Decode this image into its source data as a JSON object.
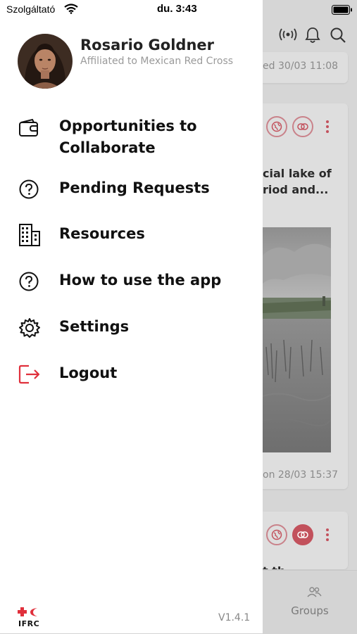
{
  "status_bar": {
    "carrier": "Szolgáltató",
    "time": "du. 3:43"
  },
  "drawer": {
    "user": {
      "name": "Rosario Goldner",
      "affiliation": "Affiliated to Mexican Red Cross"
    },
    "menu": [
      {
        "label": "Opportunities to Collaborate",
        "icon": "wallet-icon"
      },
      {
        "label": "Pending Requests",
        "icon": "question-circle-icon"
      },
      {
        "label": "Resources",
        "icon": "building-icon"
      },
      {
        "label": "How to use the app",
        "icon": "question-circle-icon"
      },
      {
        "label": "Settings",
        "icon": "gear-icon"
      },
      {
        "label": "Logout",
        "icon": "logout-icon"
      }
    ],
    "footer": {
      "logo_text": "IFRC",
      "version": "V1.4.1"
    }
  },
  "background": {
    "card1_meta": "ed 30/03 11:08",
    "card2_title_line1": "cial lake of",
    "card2_title_line2": "riod and...",
    "card2_meta": "on 28/03 15:37",
    "card3_title": "t th",
    "bottom_tab": "Groups"
  },
  "colors": {
    "accent": "#e0303c",
    "drawer_bg": "#ffffff",
    "overlay_bg": "#d6d6d6"
  }
}
